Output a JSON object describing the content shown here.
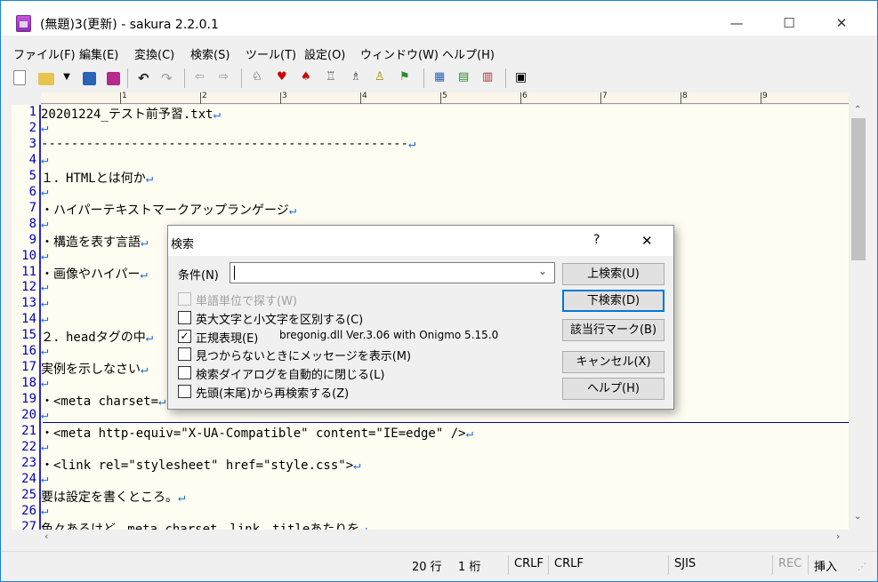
{
  "window": {
    "title": "(無題)3(更新) - sakura 2.2.0.1",
    "minimize": "—",
    "maximize": "☐",
    "close": "✕"
  },
  "menu": [
    "ファイル(F)",
    "編集(E)",
    "変換(C)",
    "検索(S)",
    "ツール(T)",
    "設定(O)",
    "ウィンドウ(W)",
    "ヘルプ(H)"
  ],
  "ruler": [
    "1",
    "2",
    "3",
    "4",
    "5",
    "6",
    "7",
    "8",
    "9"
  ],
  "editor": {
    "line_numbers": [
      "1",
      "2",
      "3",
      "4",
      "5",
      "6",
      "7",
      "8",
      "9",
      "10",
      "11",
      "12",
      "13",
      "14",
      "15",
      "16",
      "17",
      "18",
      "19",
      "20",
      "21",
      "22",
      "23",
      "24",
      "25",
      "26",
      "27"
    ],
    "lines": [
      "20201224_テスト前予習.txt",
      "",
      "-------------------------------------------------",
      "",
      "１．HTMLとは何か",
      "",
      "・ハイパーテキストマークアップランゲージ",
      "",
      "・構造を表す言語",
      "",
      "・画像やハイパー",
      "",
      " ",
      "",
      "２．headタグの中",
      "",
      "実例を示しなさい",
      "",
      "・<meta charset=",
      "",
      "・<meta http-equiv=\"X-UA-Compatible\" content=\"IE=edge\" />",
      "",
      "・<link rel=\"stylesheet\" href=\"style.css\">",
      "",
      "要は設定を書くところ。",
      "",
      "色々あるけど、meta charset、link、titleあたりを"
    ],
    "newline_mark": "↵"
  },
  "status": {
    "line": "20 行",
    "col": "1 桁",
    "eol1": "CRLF",
    "eol2": "CRLF",
    "encoding": "SJIS",
    "rec": "REC",
    "mode": "挿入"
  },
  "dialog": {
    "title": "検索",
    "help_mark": "?",
    "close": "✕",
    "condition_label": "条件(N)",
    "find_value": "",
    "options": [
      {
        "label": "単語単位で探す(W)",
        "checked": false,
        "disabled": true
      },
      {
        "label": "英大文字と小文字を区別する(C)",
        "checked": false,
        "disabled": false
      },
      {
        "label": "正規表現(E)",
        "checked": true,
        "disabled": false
      },
      {
        "label": "見つからないときにメッセージを表示(M)",
        "checked": false,
        "disabled": false
      },
      {
        "label": "検索ダイアログを自動的に閉じる(L)",
        "checked": false,
        "disabled": false
      },
      {
        "label": "先頭(末尾)から再検索する(Z)",
        "checked": false,
        "disabled": false
      }
    ],
    "regex_library": "bregonig.dll Ver.3.06 with Onigmo 5.15.0",
    "buttons": {
      "up": "上検索(U)",
      "down": "下検索(D)",
      "mark": "該当行マーク(B)",
      "cancel": "キャンセル(X)",
      "help": "ヘルプ(H)"
    }
  }
}
